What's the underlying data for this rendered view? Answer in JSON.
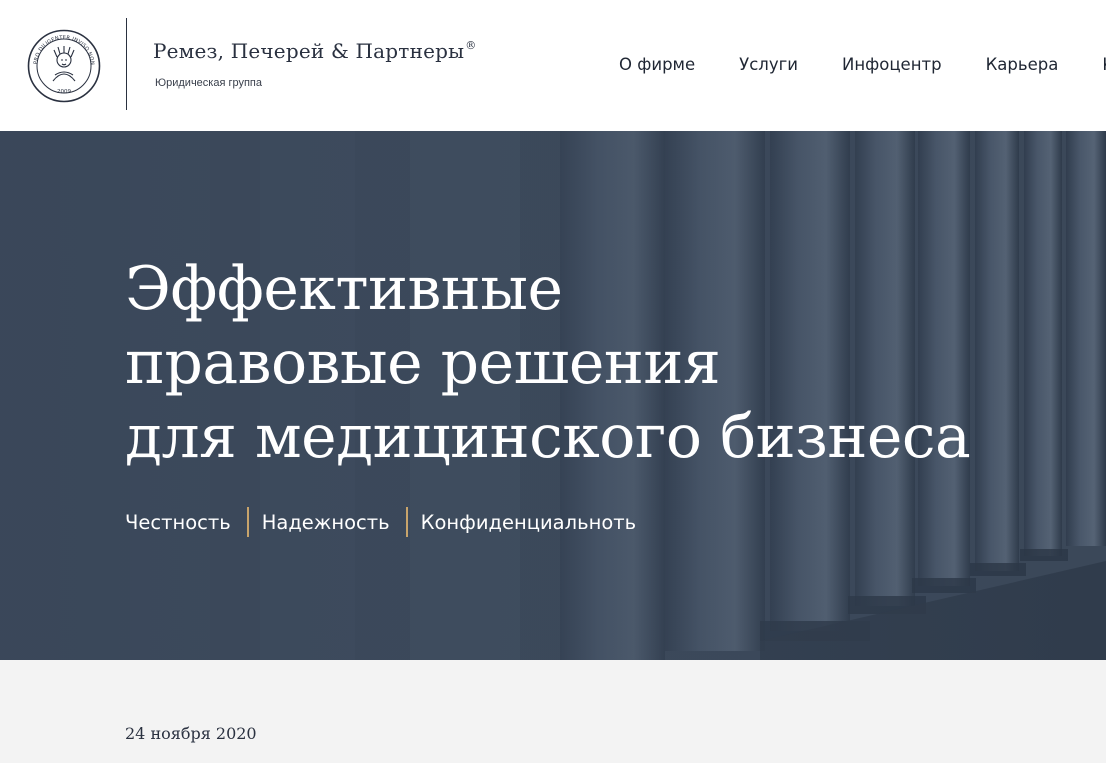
{
  "brand": {
    "name": "Ремез, Печерей & Партнеры",
    "registered_mark": "®",
    "tagline": "Юридическая группа",
    "seal_text_top": "PRO DILIGENTER INVISO NON DETAILIS",
    "seal_year": "2009"
  },
  "nav": {
    "items": [
      {
        "label": "О фирме"
      },
      {
        "label": "Услуги"
      },
      {
        "label": "Инфоцентр"
      },
      {
        "label": "Карьера"
      },
      {
        "label": "Ко"
      }
    ]
  },
  "hero": {
    "title_lines": [
      "Эффективные",
      "правовые решения",
      "для медицинского бизнеса"
    ],
    "values": [
      "Честность",
      "Надежность",
      "Конфиденциальноть"
    ]
  },
  "content": {
    "date": "24 ноября 2020"
  },
  "colors": {
    "hero_bg": "#3c4a5d",
    "accent_separator": "#c8a46b",
    "text_dark": "#1f2633",
    "page_bg": "#f3f3f3"
  }
}
